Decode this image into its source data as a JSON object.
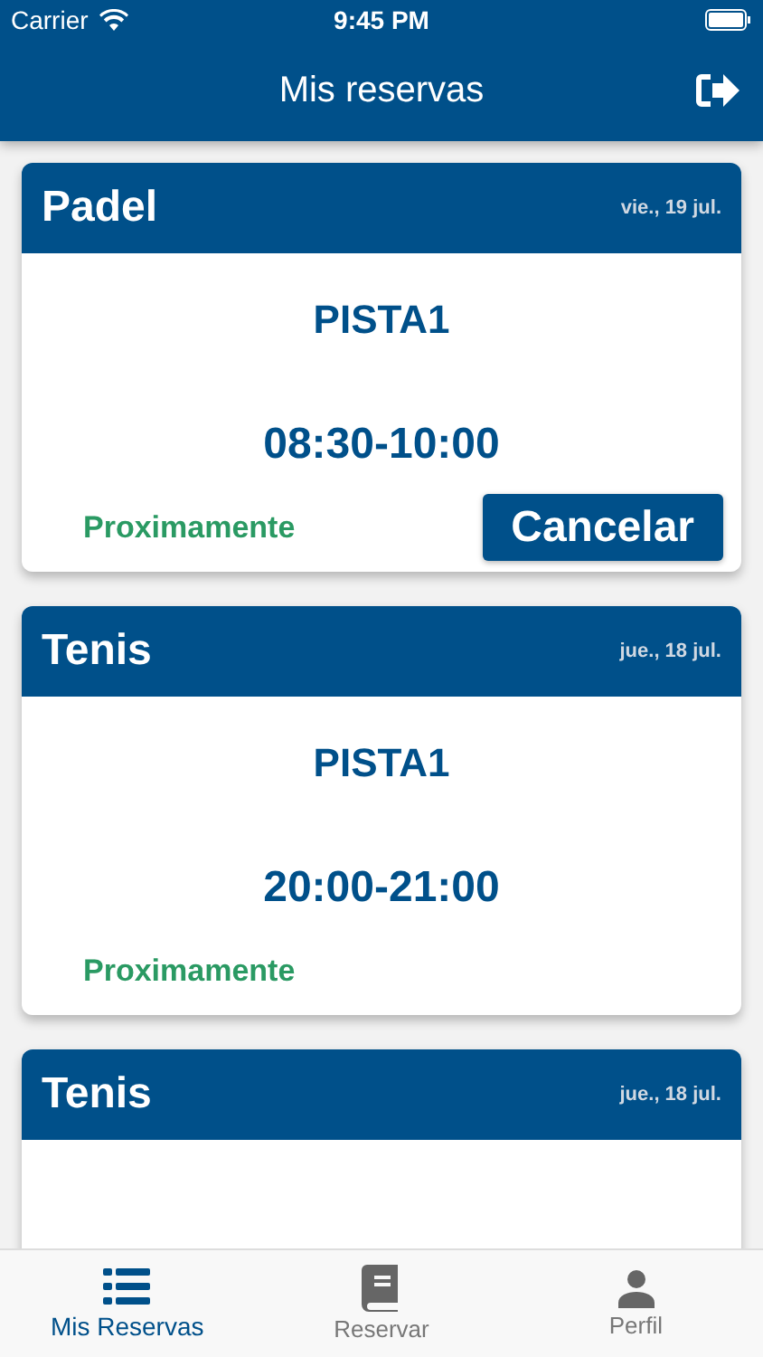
{
  "status_bar": {
    "carrier": "Carrier",
    "time": "9:45 PM"
  },
  "header": {
    "title": "Mis reservas"
  },
  "reservations": [
    {
      "sport": "Padel",
      "date": "vie., 19 jul.",
      "court": "PISTA1",
      "time": "08:30-10:00",
      "status": "Proximamente",
      "cancel_label": "Cancelar"
    },
    {
      "sport": "Tenis",
      "date": "jue., 18 jul.",
      "court": "PISTA1",
      "time": "20:00-21:00",
      "status": "Proximamente"
    },
    {
      "sport": "Tenis",
      "date": "jue., 18 jul."
    }
  ],
  "tabs": [
    {
      "kind": "list",
      "label": "Mis Reservas",
      "selected": true
    },
    {
      "kind": "book",
      "label": "Reservar",
      "selected": false
    },
    {
      "kind": "person",
      "label": "Perfil",
      "selected": false
    }
  ]
}
